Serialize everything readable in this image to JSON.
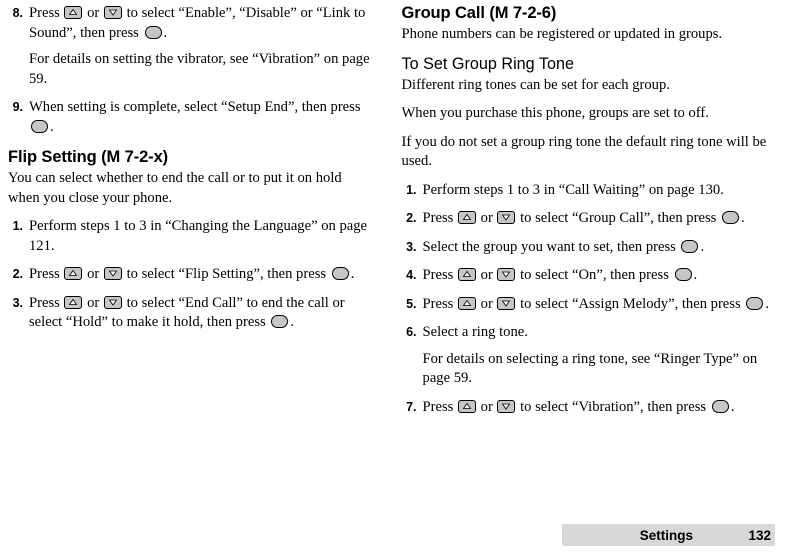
{
  "left_column": {
    "steps_top": [
      {
        "num": "8.",
        "lines": [
          "Press ⬆ or ⬇ to select “Enable”, “Disable” or “Link to Sound”, then press ◯.",
          "For details on setting the vibrator, see “Vibration” on page 59."
        ]
      },
      {
        "num": "9.",
        "lines": [
          "When setting is complete, select “Setup End”, then press ◯."
        ]
      }
    ],
    "section_heading": "Flip Setting (M 7-2-x)",
    "section_intro": "You can select whether to end the call or to put it on hold when you close your phone.",
    "steps": [
      {
        "num": "1.",
        "lines": [
          "Perform steps 1 to 3 in “Changing the Language” on page 121."
        ]
      },
      {
        "num": "2.",
        "lines": [
          "Press ⬆ or ⬇ to select “Flip Setting”, then press ◯."
        ]
      },
      {
        "num": "3.",
        "lines": [
          "Press ⬆ or ⬇ to select “End Call” to end the call or select “Hold” to make it hold, then press ◯."
        ]
      }
    ]
  },
  "right_column": {
    "section_heading": "Group Call (M 7-2-6)",
    "section_intro": "Phone numbers can be registered or updated in groups.",
    "sub_heading": "To Set Group Ring Tone",
    "paragraphs": [
      "Different ring tones can be set for each group.",
      "When you purchase this phone, groups are set to off.",
      "If you do not set a group ring tone the default ring tone will be used."
    ],
    "steps": [
      {
        "num": "1.",
        "lines": [
          "Perform steps 1 to 3 in “Call Waiting” on page 130."
        ]
      },
      {
        "num": "2.",
        "lines": [
          "Press ⬆ or ⬇ to select “Group Call”, then press ◯."
        ]
      },
      {
        "num": "3.",
        "lines": [
          "Select the group you want to set, then press ◯."
        ]
      },
      {
        "num": "4.",
        "lines": [
          "Press ⬆ or ⬇ to select “On”, then press ◯."
        ]
      },
      {
        "num": "5.",
        "lines": [
          "Press ⬆ or ⬇ to select “Assign Melody”, then press ◯."
        ]
      },
      {
        "num": "6.",
        "lines": [
          "Select a ring tone.",
          "For details on selecting a ring tone, see “Ringer Type” on page 59."
        ]
      },
      {
        "num": "7.",
        "lines": [
          "Press ⬆ or ⬇ to select “Vibration”, then press ◯."
        ]
      }
    ]
  },
  "text": {
    "press": "Press",
    "or": "or",
    "to_select": "to select",
    "then_press": ", then press",
    "period": ".",
    "s8_opt1": "“Enable”, “Disable” or",
    "s8_opt2": "“Link to Sound”",
    "s8_detail": "For details on setting the vibrator, see “Vibration” on page 59.",
    "s9_text": "When setting is complete, select “Setup End”, then press",
    "flip_intro": "You can select whether to end the call or to put it on hold when you close your phone.",
    "f1_text": "Perform steps 1 to 3 in “Changing the Language” on page 121.",
    "f2_sel": "“Flip Setting”",
    "f3_a": "“End Call” to end the call",
    "f3_b": "or select “Hold” to make it hold, then press",
    "g1_text": "Perform steps 1 to 3 in “Call Waiting” on page 130.",
    "g2_sel": "“Group Call”",
    "g3_text": "Select the group you want to set, then press",
    "g4_sel": "“On”",
    "g5_sel": "“Assign Melody”",
    "g6_text": "Select a ring tone.",
    "g6_detail": "For details on selecting a ring tone, see “Ringer Type” on page 59.",
    "g7_sel": "“Vibration”"
  },
  "footer": {
    "label": "Settings",
    "page": "132"
  }
}
